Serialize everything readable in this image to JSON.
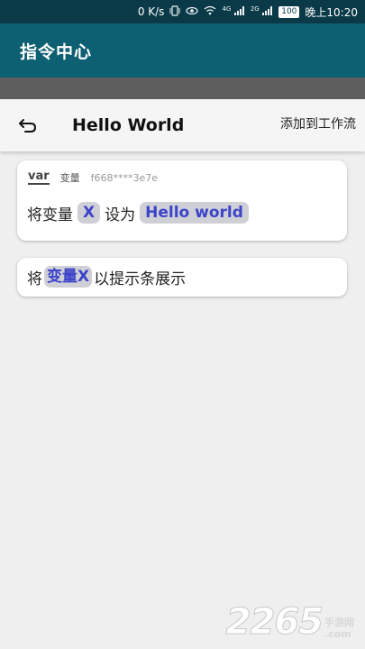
{
  "status_bar": {
    "speed": "0 K/s",
    "network1": "4G",
    "network2": "2G",
    "battery": "100",
    "time": "晚上10:20"
  },
  "app_bar": {
    "title": "指令中心"
  },
  "toolbar": {
    "title": "Hello World",
    "add_label": "添加到工作流"
  },
  "card1": {
    "icon_text": "var",
    "label": "变量",
    "id": "f668****3e7e",
    "prefix": "将变量",
    "var_name": "X",
    "middle": "设为",
    "value": "Hello world"
  },
  "card2": {
    "prefix": "将",
    "var_ref": "变量X",
    "suffix": "以提示条展示"
  },
  "watermark": {
    "number": "2265",
    "line1": "手游网",
    "line2": ".com"
  },
  "colors": {
    "status_bar": "#0a3a48",
    "app_bar": "#0d5f72",
    "chip_bg": "#cfcfd6",
    "chip_text": "#3c44c9"
  }
}
